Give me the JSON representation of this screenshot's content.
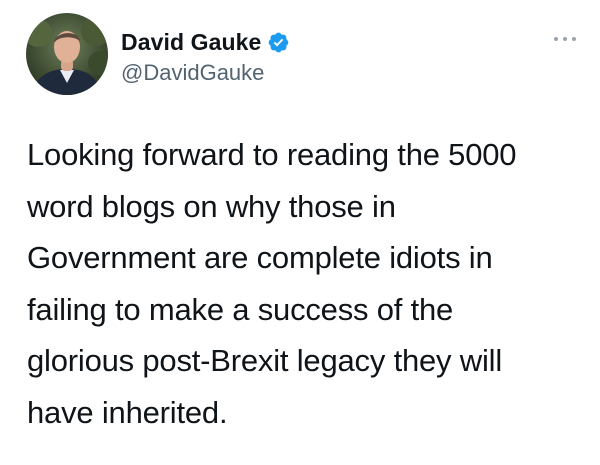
{
  "tweet": {
    "author": {
      "display_name": "David Gauke",
      "handle": "@DavidGauke",
      "verified": true,
      "avatar_icon": "profile-photo"
    },
    "more_icon": "ellipsis-icon",
    "text": "Looking forward to reading the 5000\nword blogs on why those in\nGovernment are complete idiots in\nfailing to make a success of the\nglorious post-Brexit legacy they will\nhave inherited."
  },
  "colors": {
    "verified_badge": "#1d9bf0",
    "handle_text": "#536471",
    "body_text": "#0f1419"
  }
}
